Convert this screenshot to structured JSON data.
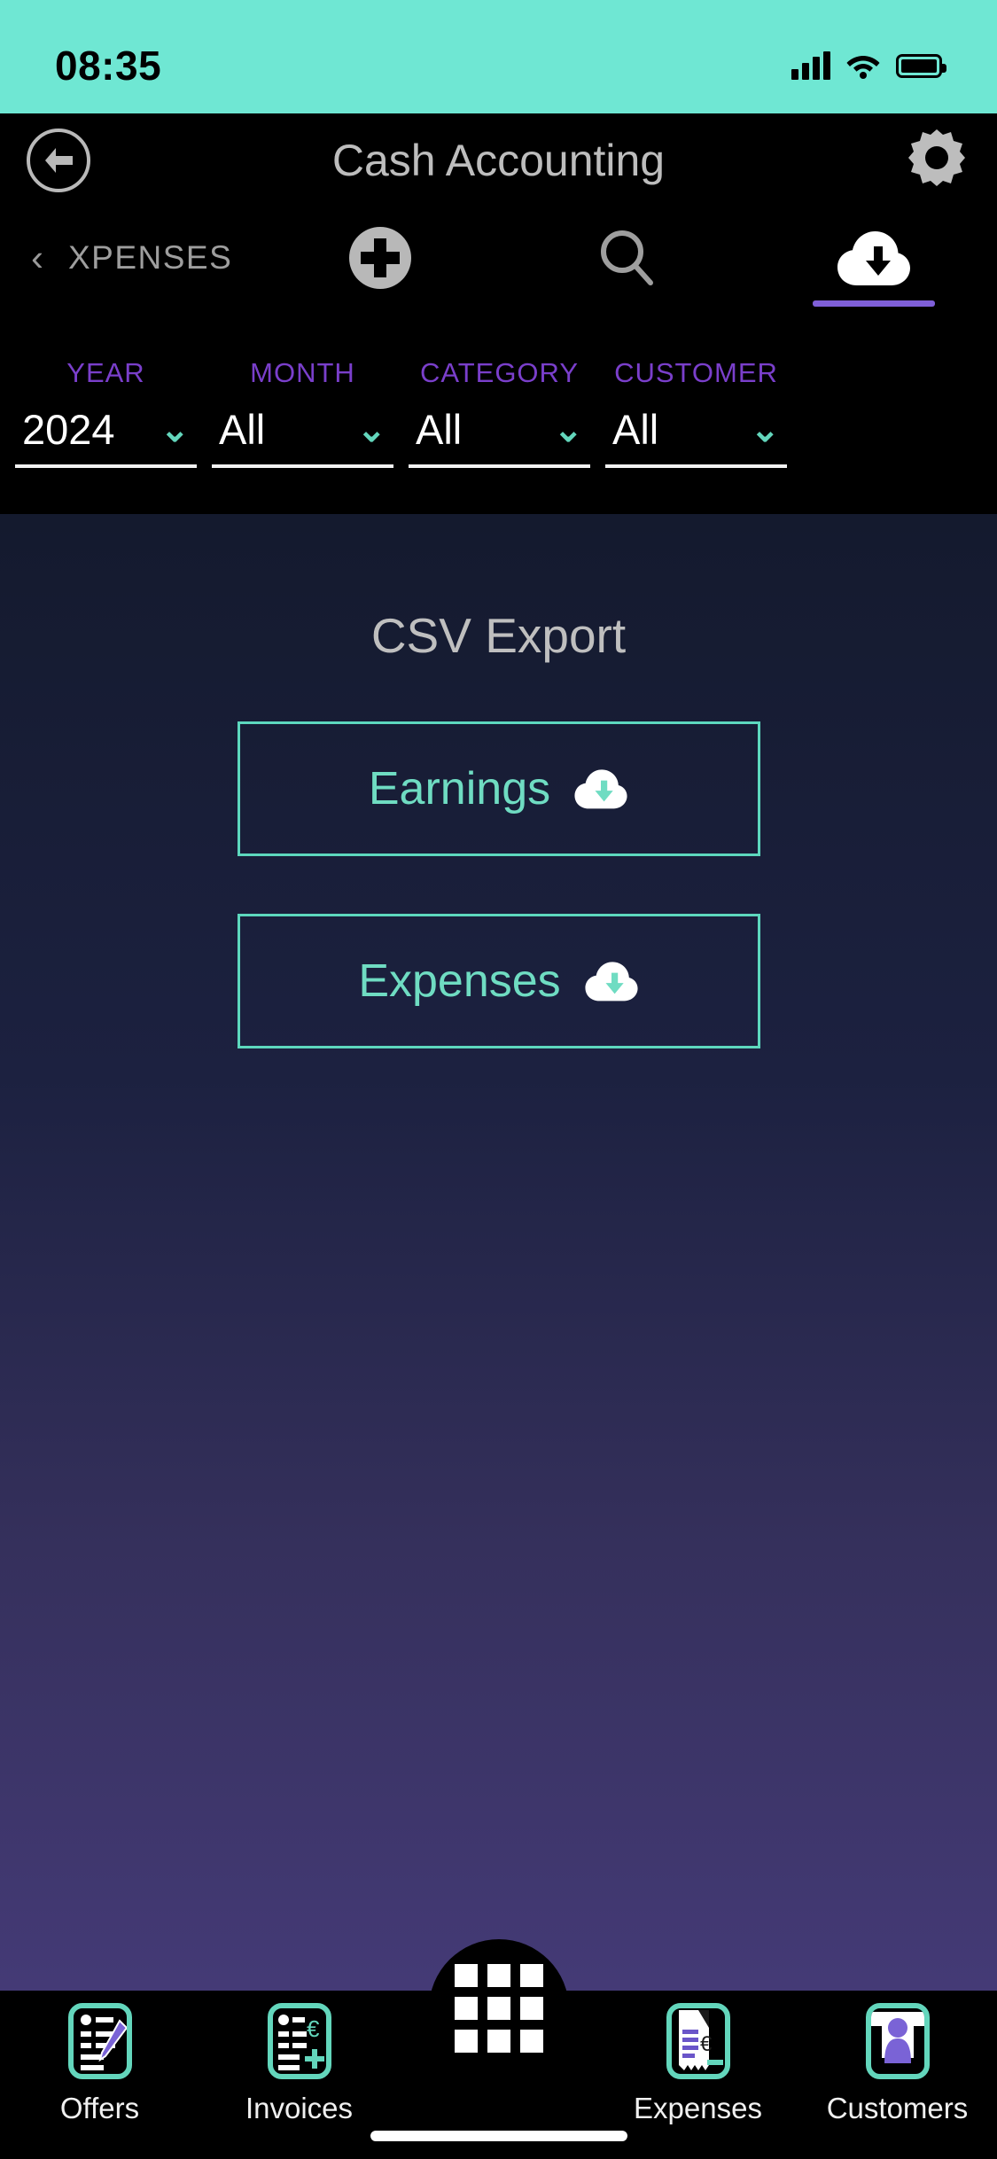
{
  "status_bar": {
    "time": "08:35",
    "signal_icon": "signal-bars-icon",
    "wifi_icon": "wifi-icon",
    "battery_icon": "battery-icon",
    "background_color": "#6FE7D3"
  },
  "app_bar": {
    "back_icon": "back-arrow-icon",
    "title": "Cash Accounting",
    "settings_icon": "gear-icon"
  },
  "tab_bar": {
    "prev_icon": "chevron-left-icon",
    "section_label": "XPENSES",
    "tabs": [
      {
        "name": "add",
        "icon": "plus-circle-icon",
        "active": false
      },
      {
        "name": "search",
        "icon": "search-icon",
        "active": false
      },
      {
        "name": "export",
        "icon": "cloud-download-icon",
        "active": true
      }
    ],
    "active_indicator_color": "#7F5FD8"
  },
  "filters": {
    "label_color": "#7A3FCB",
    "chevron_color": "#63D6BC",
    "items": [
      {
        "label": "YEAR",
        "value": "2024",
        "chevron": "chevron-down-icon"
      },
      {
        "label": "MONTH",
        "value": "All",
        "chevron": "chevron-down-icon"
      },
      {
        "label": "CATEGORY",
        "value": "All",
        "chevron": "chevron-down-icon"
      },
      {
        "label": "CUSTOMER",
        "value": "All",
        "chevron": "chevron-down-icon"
      }
    ]
  },
  "main": {
    "heading": "CSV Export",
    "accent_color": "#63D6BC",
    "buttons": [
      {
        "label": "Earnings",
        "icon": "cloud-download-icon"
      },
      {
        "label": "Expenses",
        "icon": "cloud-download-icon"
      }
    ]
  },
  "bottom_nav": {
    "items": [
      {
        "label": "Offers",
        "icon": "document-pencil-icon"
      },
      {
        "label": "Invoices",
        "icon": "invoice-euro-plus-icon"
      },
      {
        "label": "",
        "icon": "grid-menu-icon"
      },
      {
        "label": "Expenses",
        "icon": "receipt-euro-icon"
      },
      {
        "label": "Customers",
        "icon": "person-icon"
      }
    ]
  }
}
